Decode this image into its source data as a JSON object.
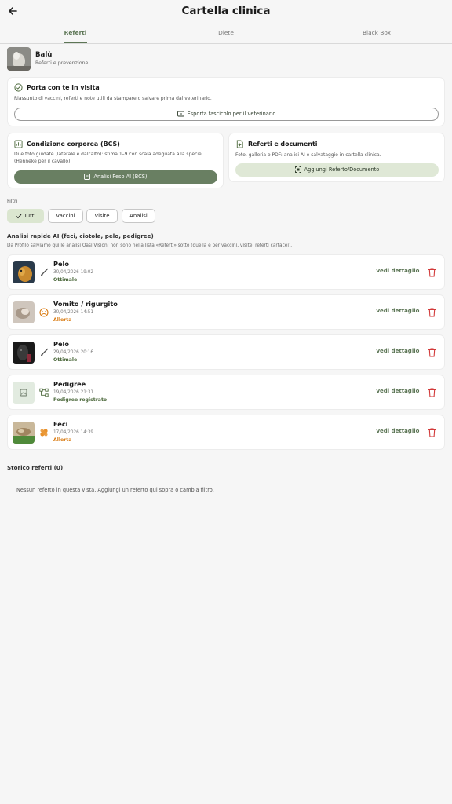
{
  "header": {
    "title": "Cartella clinica"
  },
  "tabs": [
    {
      "label": "Referti",
      "active": true
    },
    {
      "label": "Diete",
      "active": false
    },
    {
      "label": "Black Box",
      "active": false
    }
  ],
  "pet": {
    "name": "Balù",
    "subtitle": "Referti e prevenzione"
  },
  "visit_card": {
    "title": "Porta con te in visita",
    "text": "Riassunto di vaccini, referti e note utili da stampare o salvare prima dal veterinario.",
    "button": "Esporta fascicolo per il veterinario"
  },
  "bcs_card": {
    "title": "Condizione corporea (BCS)",
    "text": "Due foto guidate (laterale e dall'alto): stima 1–9 con scala adeguata alla specie (Henneke per il cavallo).",
    "button": "Analisi Peso AI (BCS)"
  },
  "docs_card": {
    "title": "Referti e documenti",
    "text": "Foto, galleria o PDF: analisi AI e salvataggio in cartella clinica.",
    "button": "Aggiungi Referto/Documento"
  },
  "filters": {
    "label": "Filtri",
    "chips": [
      {
        "label": "Tutti",
        "selected": true
      },
      {
        "label": "Vaccini",
        "selected": false
      },
      {
        "label": "Visite",
        "selected": false
      },
      {
        "label": "Analisi",
        "selected": false
      }
    ]
  },
  "ai_section": {
    "title": "Analisi rapide AI (feci, ciotola, pelo, pedigree)",
    "subtitle": "Da Profilo salviamo qui le analisi Oasi Vision: non sono nella lista «Referti» sotto (quella è per vaccini, visite, referti cartacei)."
  },
  "analyses": [
    {
      "title": "Pelo",
      "date": "30/04/2026 19:02",
      "status": "Ottimale",
      "status_color": "#4f6b3f",
      "icon": "brush-icon",
      "thumb": "dog-photo"
    },
    {
      "title": "Vomito / rigurgito",
      "date": "30/04/2026 14:51",
      "status": "Allerta",
      "status_color": "#d97a10",
      "icon": "sick-face-icon",
      "thumb": "vomit-photo"
    },
    {
      "title": "Pelo",
      "date": "29/04/2026 20:16",
      "status": "Ottimale",
      "status_color": "#4f6b3f",
      "icon": "brush-icon",
      "thumb": "dog-photo"
    },
    {
      "title": "Pedigree",
      "date": "19/04/2026 21:31",
      "status": "Pedigree registrato",
      "status_color": "#4f6b3f",
      "icon": "family-tree-icon",
      "thumb": "image-placeholder"
    },
    {
      "title": "Feci",
      "date": "17/04/2026 14:39",
      "status": "Allerta",
      "status_color": "#d97a10",
      "icon": "bandage-icon",
      "thumb": "feces-photo"
    }
  ],
  "detail_label": "Vedi dettaglio",
  "history": {
    "title": "Storico referti (0)",
    "empty": "Nessun referto in questa vista. Aggiungi un referto qui sopra o cambia filtro."
  },
  "colors": {
    "accent": "#5d7656",
    "alert": "#d97a10",
    "delete": "#d23a3a"
  }
}
